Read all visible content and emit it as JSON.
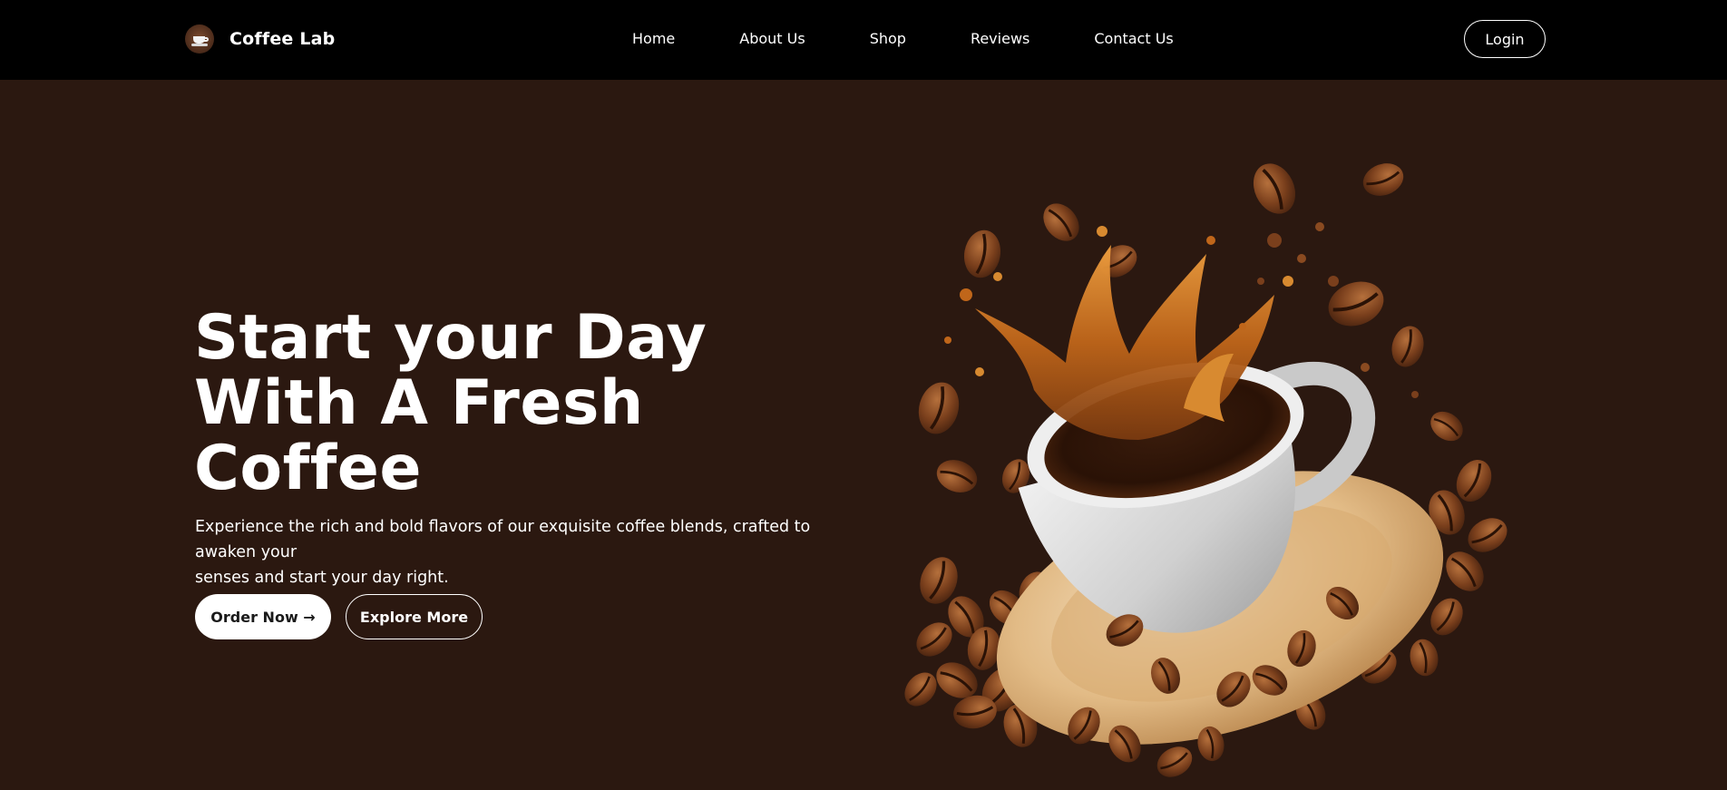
{
  "nav": {
    "brand": "Coffee Lab",
    "links": [
      "Home",
      "About Us",
      "Shop",
      "Reviews",
      "Contact Us"
    ],
    "login": "Login"
  },
  "hero": {
    "title_lines": [
      "Start your Day",
      "With A Fresh",
      "Coffee"
    ],
    "description_lines": [
      "Experience the rich and bold flavors of our exquisite coffee blends, crafted to awaken your",
      "senses and start your day right."
    ],
    "order_button": "Order Now →",
    "explore_button": "Explore More"
  },
  "icons": {
    "logo": "coffee-cup-icon"
  },
  "colors": {
    "navbar_bg": "#000000",
    "page_bg": "#2b1810",
    "text": "#ffffff"
  }
}
